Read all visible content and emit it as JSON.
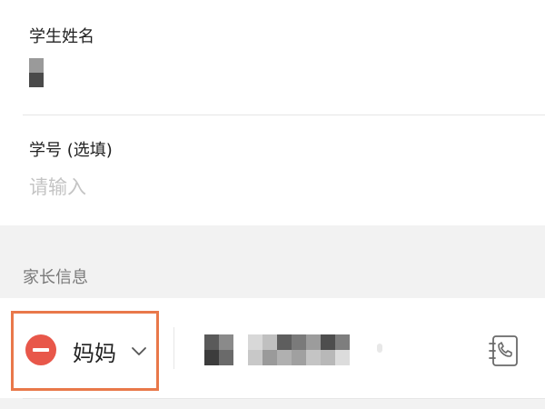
{
  "form": {
    "student_name": {
      "label": "学生姓名",
      "value_masked": true
    },
    "student_id": {
      "label": "学号 (选填)",
      "placeholder": "请输入",
      "value": ""
    }
  },
  "parents_section": {
    "title": "家长信息",
    "entries": [
      {
        "relation": "妈妈",
        "phone_masked": true
      }
    ]
  },
  "icons": {
    "remove": "remove-circle-icon",
    "dropdown": "chevron-down-icon",
    "contacts": "contacts-phone-icon"
  },
  "colors": {
    "remove_button": "#e8574a",
    "highlight_border": "#e9784a",
    "placeholder": "#c4c4c4",
    "section_label": "#7a7a7a",
    "page_background": "#f2f2f2"
  }
}
